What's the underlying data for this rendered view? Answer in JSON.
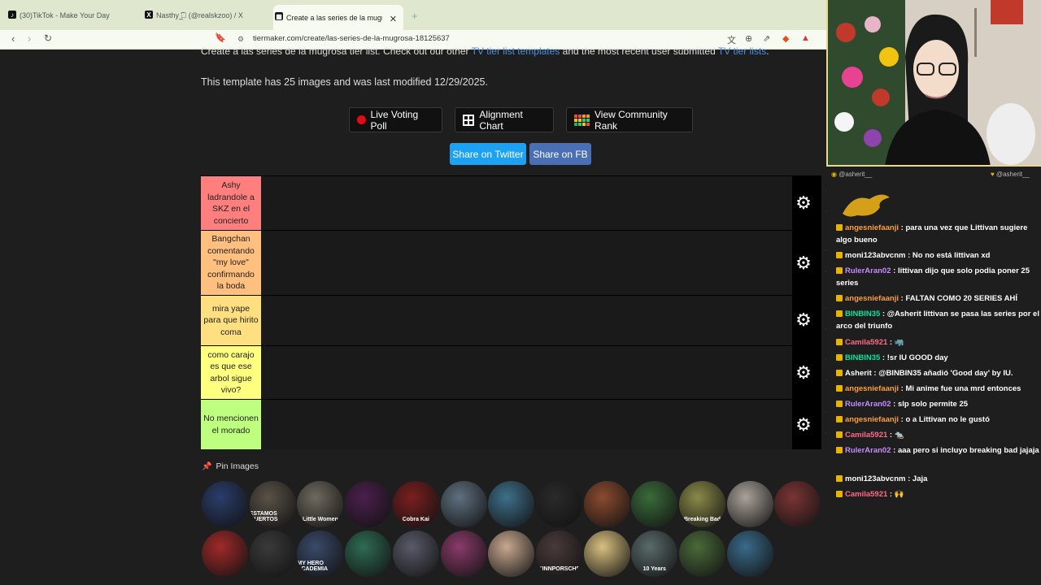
{
  "browser": {
    "tabs": [
      {
        "title": "(30)TikTok - Make Your Day",
        "icon": "tiktok-icon"
      },
      {
        "title": "Nasthy ؞̲͙͡ (@realskzoo) / X",
        "icon": "x-icon"
      },
      {
        "title": "Create a las series de la mugrosa",
        "icon": "tiermaker-icon"
      }
    ],
    "url": "tiermaker.com/create/las-series-de-la-mugrosa-18125637"
  },
  "page": {
    "intro_line1_start": "Create a las series de la mugrosa tier list. Check out our other ",
    "intro_link1": "TV tier list templates",
    "intro_line1_mid": " and the most recent user submitted ",
    "intro_link2": "TV tier lists",
    "intro_line1_end": ".",
    "intro_line2": "This template has 25 images and was last modified 12/29/2025.",
    "buttons": {
      "live_voting": "Live Voting Poll",
      "alignment": "Alignment Chart",
      "community_rank": "View Community Rank",
      "share_twitter": "Share on Twitter",
      "share_fb": "Share on FB"
    },
    "tiers": [
      {
        "label": "Ashy ladrandole a SKZ en el concierto",
        "color": "#ff7f7f"
      },
      {
        "label": "Bangchan comentando \"my love\" confirmando la boda",
        "color": "#ffbf7f"
      },
      {
        "label": "mira yape para que hirito coma",
        "color": "#ffdf7f"
      },
      {
        "label": "como carajo es que ese arbol sigue vivo?",
        "color": "#ffff7f"
      },
      {
        "label": "No mencionen el morado",
        "color": "#bfff7f"
      }
    ],
    "pin_images": "Pin Images",
    "thumbnails_row1": [
      "",
      "ESTAMOS MUERTOS",
      "Little Women",
      "",
      "Cobra Kai",
      "",
      "",
      "",
      "",
      "",
      "Breaking Bad",
      "",
      ""
    ],
    "thumbnails_row2": [
      "",
      "",
      "MY HERO ACADEMIA",
      "",
      "",
      "",
      "",
      "KINNPORSCHE",
      "",
      "10 Years",
      "",
      ""
    ]
  },
  "chat": {
    "header_left": "@asherit__",
    "header_right": "@asherit__",
    "messages": [
      {
        "user": "angesniefaanji",
        "user_color": "#ff9e3d",
        "text": "para una vez que Littivan sugiere algo bueno"
      },
      {
        "user": "moni123abvcnm",
        "user_color": "#ffffff",
        "text": "No no está littivan xd"
      },
      {
        "user": "RulerAran02",
        "user_color": "#c48cff",
        "text": "littivan dijo que solo podia poner 25 series"
      },
      {
        "user": "angesniefaanji",
        "user_color": "#ff9e3d",
        "text": "FALTAN COMO 20 SERIES AHÍ"
      },
      {
        "user": "BINBIN35",
        "user_color": "#00e5a0",
        "text": "@Asherit littivan se pasa las series por el arco del triunfo"
      },
      {
        "user": "Camila5921",
        "user_color": "#ff6b8b",
        "text": "🦏"
      },
      {
        "user": "BINBIN35",
        "user_color": "#00e5a0",
        "text": "!sr IU GOOD day"
      },
      {
        "user": "Asherit",
        "user_color": "#ffffff",
        "text": "@BINBIN35 añadió 'Good day' by IU."
      },
      {
        "user": "angesniefaanji",
        "user_color": "#ff9e3d",
        "text": "Mi anime fue una mrd entonces"
      },
      {
        "user": "RulerAran02",
        "user_color": "#c48cff",
        "text": "slp solo permite 25"
      },
      {
        "user": "angesniefaanji",
        "user_color": "#ff9e3d",
        "text": "o a Littivan no le gustó"
      },
      {
        "user": "Camila5921",
        "user_color": "#ff6b8b",
        "text": "🐀"
      },
      {
        "user": "RulerAran02",
        "user_color": "#c48cff",
        "text": "aaa pero si incluyo breaking bad jajaja"
      },
      {
        "user": "moni123abvcnm",
        "user_color": "#ffffff",
        "text": "Jaja"
      },
      {
        "user": "Camila5921",
        "user_color": "#ff6b8b",
        "text": "🙌"
      }
    ]
  }
}
